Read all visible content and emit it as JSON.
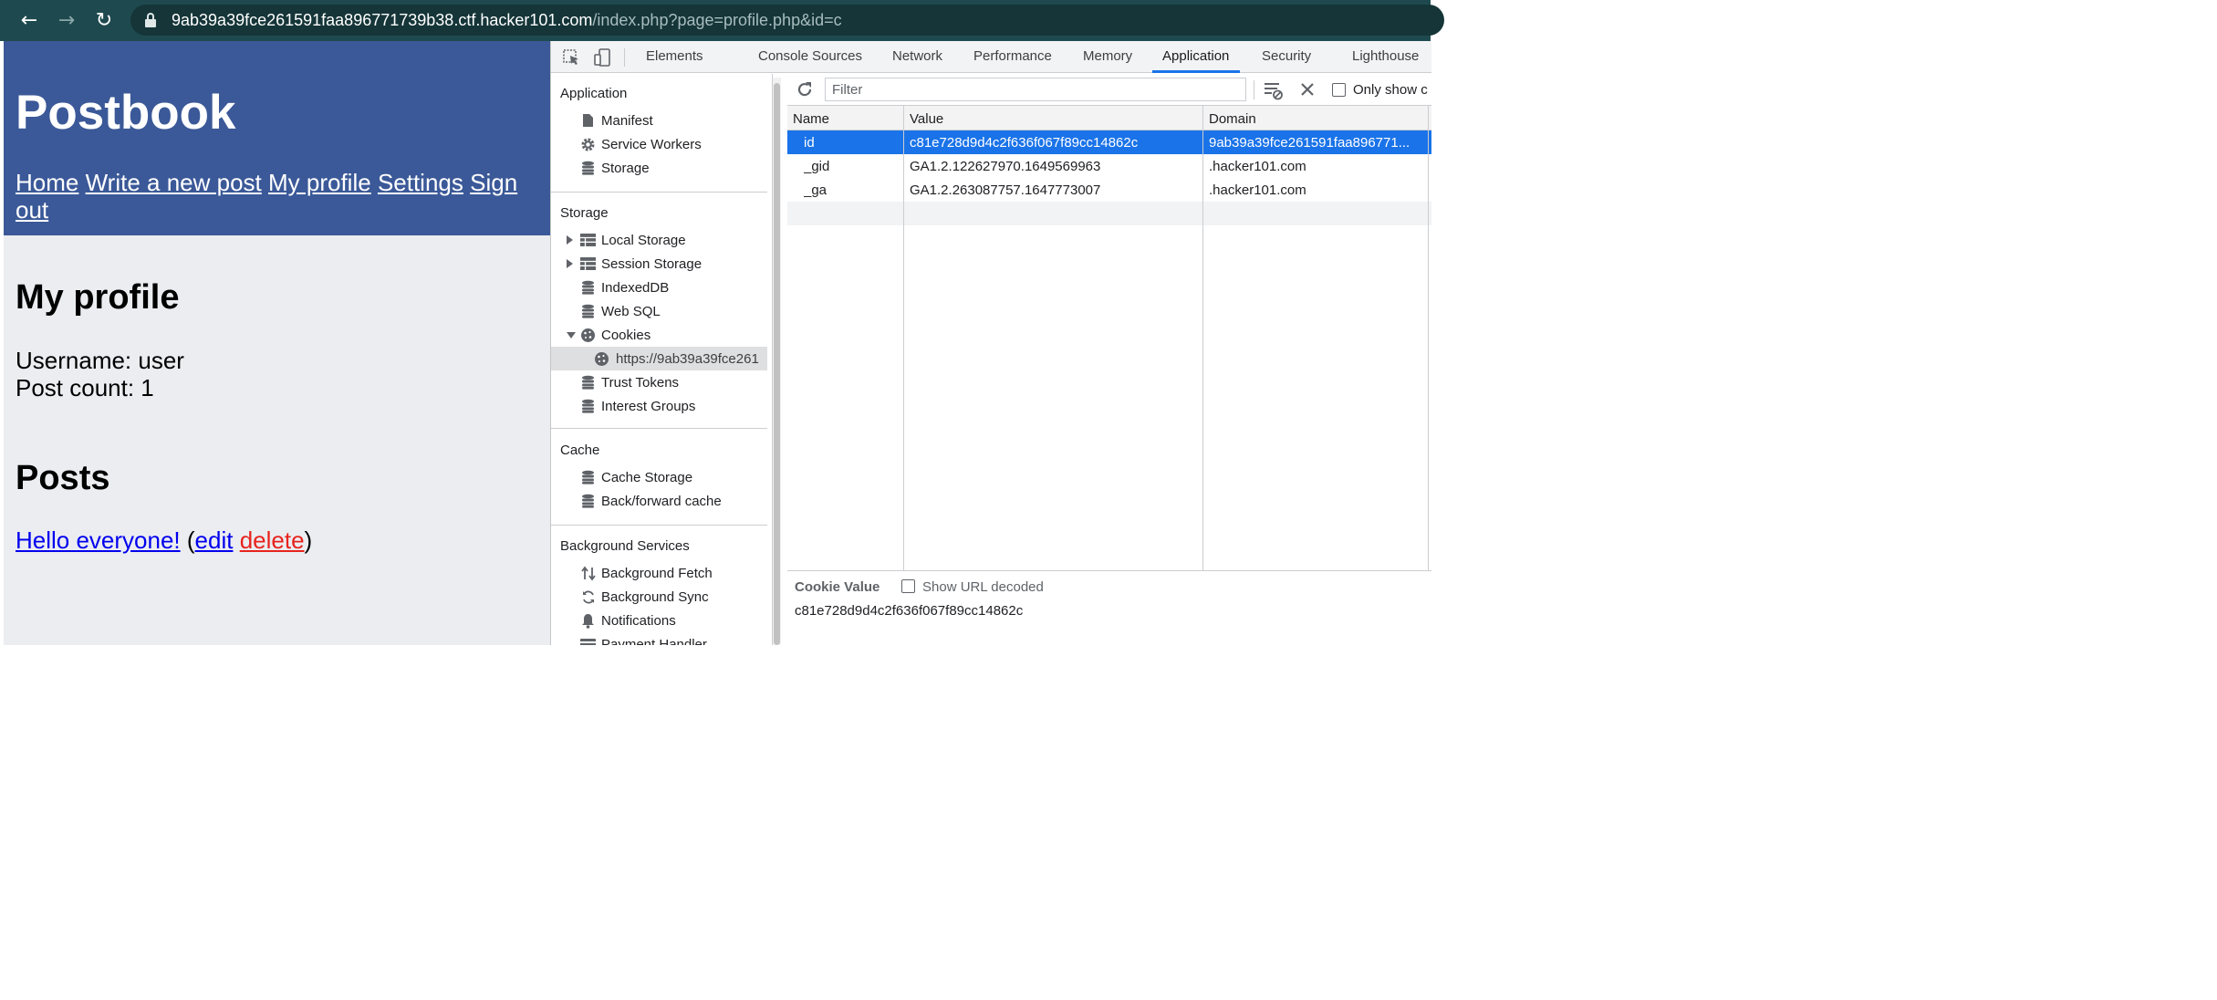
{
  "browser": {
    "url_host": "9ab39a39fce261591faa896771739b38.ctf.hacker101.com",
    "url_path": "/index.php?page=profile.php&id=c",
    "back_icon": "←",
    "forward_icon": "→",
    "reload_icon": "↻"
  },
  "site": {
    "brand": "Postbook",
    "nav": [
      "Home",
      "Write a new post",
      "My profile",
      "Settings",
      "Sign out"
    ],
    "profile_title": "My profile",
    "username": "Username: user",
    "post_count": "Post count: 1",
    "posts_title": "Posts",
    "post": {
      "title": "Hello everyone!",
      "open": " (",
      "edit": "edit",
      "delete": "delete",
      "close": ")"
    },
    "colors": {
      "header": "#3b5998",
      "link": "#0000ee",
      "delete": "#e8231d"
    }
  },
  "devtools": {
    "tabs": [
      "Elements",
      "Console",
      "Sources",
      "Network",
      "Performance",
      "Memory",
      "Application",
      "Security",
      "Lighthouse"
    ],
    "active_tab": "Application",
    "sidebar": {
      "application": {
        "title": "Application",
        "items": [
          "Manifest",
          "Service Workers",
          "Storage"
        ]
      },
      "storage": {
        "title": "Storage",
        "items": [
          "Local Storage",
          "Session Storage",
          "IndexedDB",
          "Web SQL",
          "Cookies",
          "https://9ab39a39fce261",
          "Trust Tokens",
          "Interest Groups"
        ]
      },
      "cache": {
        "title": "Cache",
        "items": [
          "Cache Storage",
          "Back/forward cache"
        ]
      },
      "background": {
        "title": "Background Services",
        "items": [
          "Background Fetch",
          "Background Sync",
          "Notifications",
          "Payment Handler"
        ]
      }
    },
    "toolbar": {
      "filter_placeholder": "Filter",
      "only_show": "Only show c"
    },
    "table": {
      "headers": [
        "Name",
        "Value",
        "Domain"
      ],
      "rows": [
        {
          "name": "id",
          "value": "c81e728d9d4c2f636f067f89cc14862c",
          "domain": "9ab39a39fce261591faa896771..."
        },
        {
          "name": "_gid",
          "value": "GA1.2.122627970.1649569963",
          "domain": ".hacker101.com"
        },
        {
          "name": "_ga",
          "value": "GA1.2.263087757.1647773007",
          "domain": ".hacker101.com"
        }
      ]
    },
    "detail": {
      "title": "Cookie Value",
      "decode_label": "Show URL decoded",
      "value": "c81e728d9d4c2f636f067f89cc14862c"
    }
  }
}
